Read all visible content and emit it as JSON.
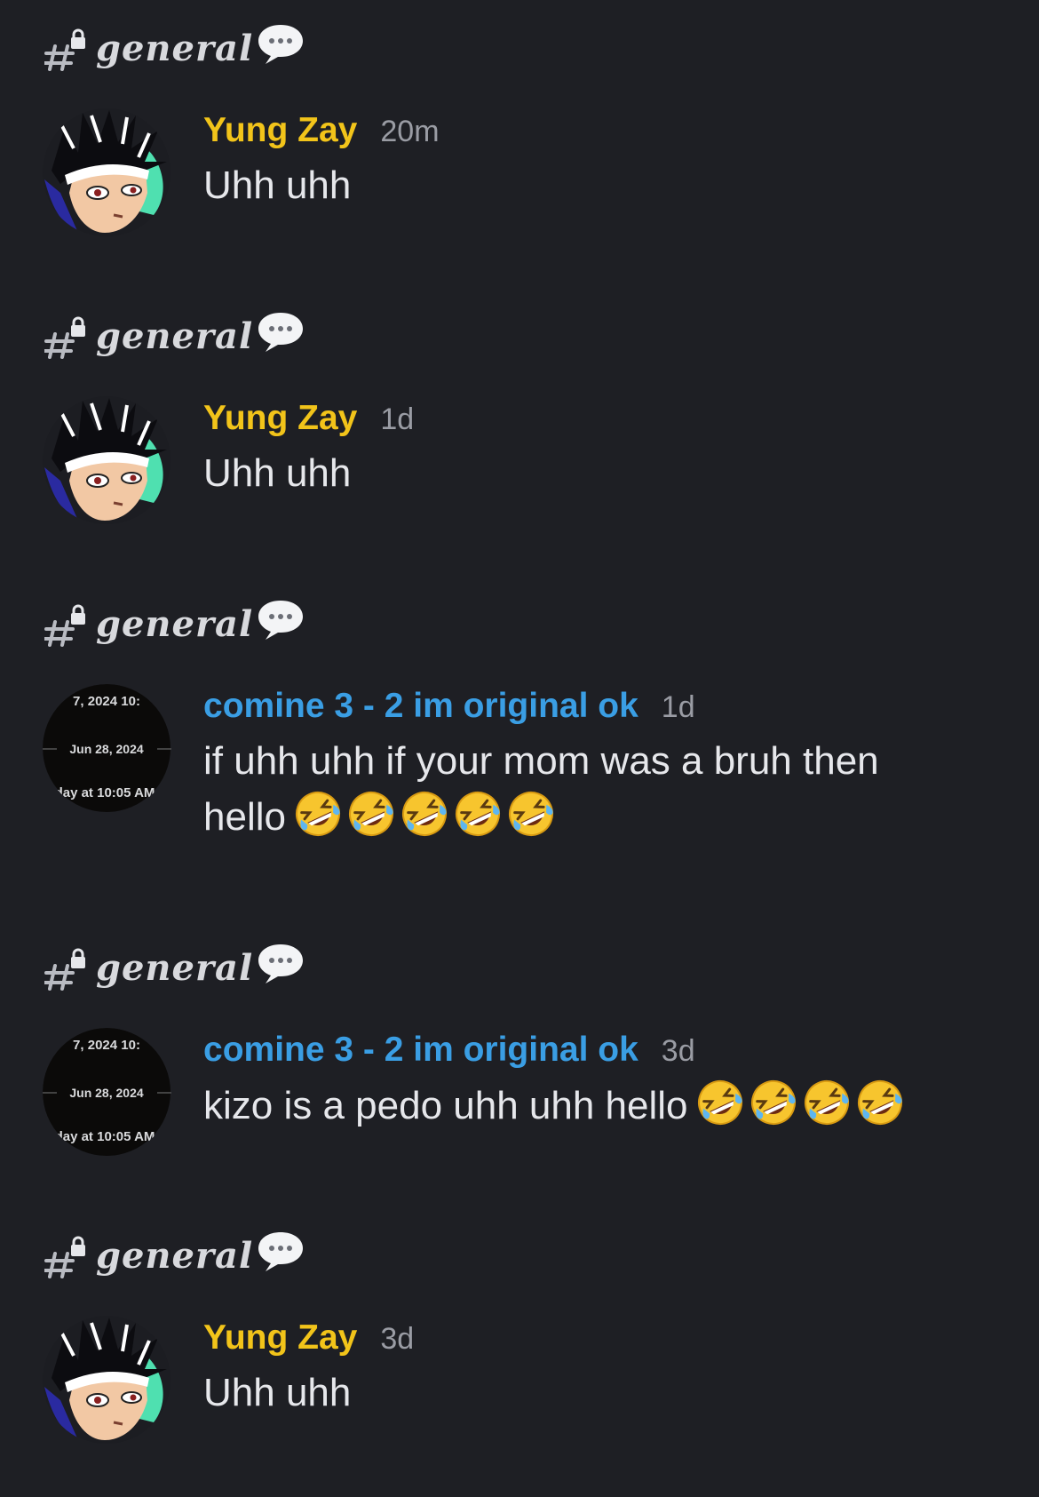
{
  "colors": {
    "background": "#1e1f24",
    "author_yellow": "#f2c41a",
    "author_blue": "#3a9ee4",
    "timestamp": "#9a9ca4",
    "text": "#e6e7eb"
  },
  "results": [
    {
      "channel": "general",
      "author": "Yung Zay",
      "author_color": "#f2c41a",
      "time": "20m",
      "text": "Uhh uhh",
      "emoji_count": 0,
      "avatar": "anime-avatar"
    },
    {
      "channel": "general",
      "author": "Yung Zay",
      "author_color": "#f2c41a",
      "time": "1d",
      "text": "Uhh uhh",
      "emoji_count": 0,
      "avatar": "anime-avatar"
    },
    {
      "channel": "general",
      "author": "comine 3 - 2 im original ok",
      "author_color": "#3a9ee4",
      "time": "1d",
      "text": "if uhh uhh if your mom was a bruh then hello",
      "emoji_count": 5,
      "emoji_icon": "rolling-on-floor-laughing-emoji",
      "avatar": "date-avatar",
      "avatar_text": {
        "top": "7, 2024 10:",
        "middle": "Jun 28, 2024",
        "bottom": "day at 10:05 AM"
      }
    },
    {
      "channel": "general",
      "author": "comine 3 - 2 im original ok",
      "author_color": "#3a9ee4",
      "time": "3d",
      "text": "kizo is a pedo uhh uhh hello",
      "emoji_count": 4,
      "emoji_icon": "rolling-on-floor-laughing-emoji",
      "avatar": "date-avatar",
      "avatar_text": {
        "top": "7, 2024 10:",
        "middle": "Jun 28, 2024",
        "bottom": "day at 10:05 AM"
      }
    },
    {
      "channel": "general",
      "author": "Yung Zay",
      "author_color": "#f2c41a",
      "time": "3d",
      "text": "Uhh uhh",
      "emoji_count": 0,
      "avatar": "anime-avatar"
    }
  ]
}
